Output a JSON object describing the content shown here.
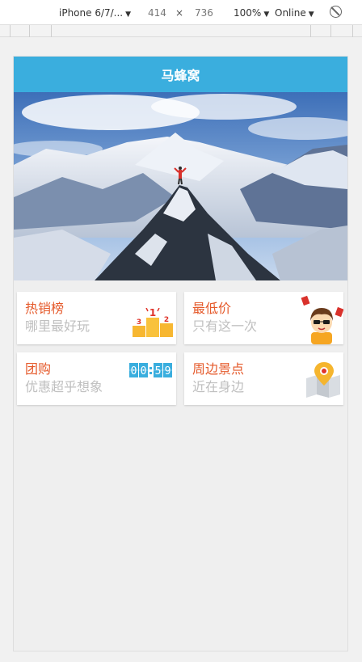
{
  "devtools": {
    "device_select": "iPhone 6/7/...",
    "width": "414",
    "times": "×",
    "height": "736",
    "zoom": "100%",
    "network": "Online"
  },
  "app": {
    "title": "马蜂窝"
  },
  "cards": [
    {
      "title": "热销榜",
      "subtitle": "哪里最好玩",
      "icon": "podium-icon"
    },
    {
      "title": "最低价",
      "subtitle": "只有这一次",
      "icon": "cartoon-boy-icon"
    },
    {
      "title": "团购",
      "subtitle": "优惠超乎想象",
      "icon": "countdown-clock-icon"
    },
    {
      "title": "周边景点",
      "subtitle": "近在身边",
      "icon": "map-pin-icon"
    }
  ],
  "countdown": {
    "digits": [
      "0",
      "0",
      "5",
      "9"
    ]
  },
  "podium": {
    "ranks": [
      "3",
      "1",
      "2"
    ]
  },
  "colors": {
    "header": "#3aaede",
    "card_title": "#e55a2b",
    "card_subtitle": "#bfbfbf"
  }
}
